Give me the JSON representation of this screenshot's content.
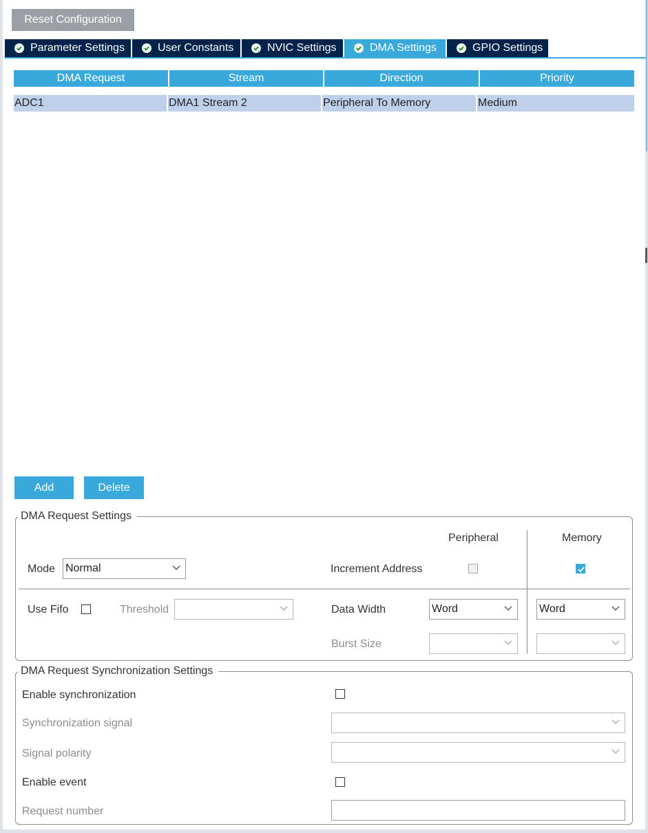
{
  "toolbar": {
    "reset_label": "Reset Configuration"
  },
  "tabs": [
    {
      "label": "Parameter Settings",
      "active": false
    },
    {
      "label": "User Constants",
      "active": false
    },
    {
      "label": "NVIC Settings",
      "active": false
    },
    {
      "label": "DMA Settings",
      "active": true
    },
    {
      "label": "GPIO Settings",
      "active": false
    }
  ],
  "dma_table": {
    "headers": [
      "DMA Request",
      "Stream",
      "Direction",
      "Priority"
    ],
    "rows": [
      [
        "ADC1",
        "DMA1 Stream 2",
        "Peripheral To Memory",
        "Medium"
      ]
    ]
  },
  "actions": {
    "add_label": "Add",
    "delete_label": "Delete"
  },
  "request_settings": {
    "title": "DMA Request Settings",
    "peripheral_header": "Peripheral",
    "memory_header": "Memory",
    "mode_label": "Mode",
    "mode_value": "Normal",
    "increment_address_label": "Increment Address",
    "peripheral_increment": false,
    "memory_increment": true,
    "use_fifo_label": "Use Fifo",
    "use_fifo": false,
    "threshold_label": "Threshold",
    "threshold_value": "",
    "data_width_label": "Data Width",
    "peripheral_data_width": "Word",
    "memory_data_width": "Word",
    "burst_size_label": "Burst Size",
    "peripheral_burst_size": "",
    "memory_burst_size": ""
  },
  "sync_settings": {
    "title": "DMA Request Synchronization Settings",
    "enable_sync_label": "Enable synchronization",
    "enable_sync": false,
    "sync_signal_label": "Synchronization signal",
    "sync_signal_value": "",
    "signal_polarity_label": "Signal polarity",
    "signal_polarity_value": "",
    "enable_event_label": "Enable event",
    "enable_event": false,
    "request_number_label": "Request number",
    "request_number_value": ""
  },
  "colors": {
    "accent": "#39a9dc",
    "tab_dark": "#03234b",
    "row_selected": "#bfd1ea",
    "reset_gray": "#9aa0a6"
  }
}
